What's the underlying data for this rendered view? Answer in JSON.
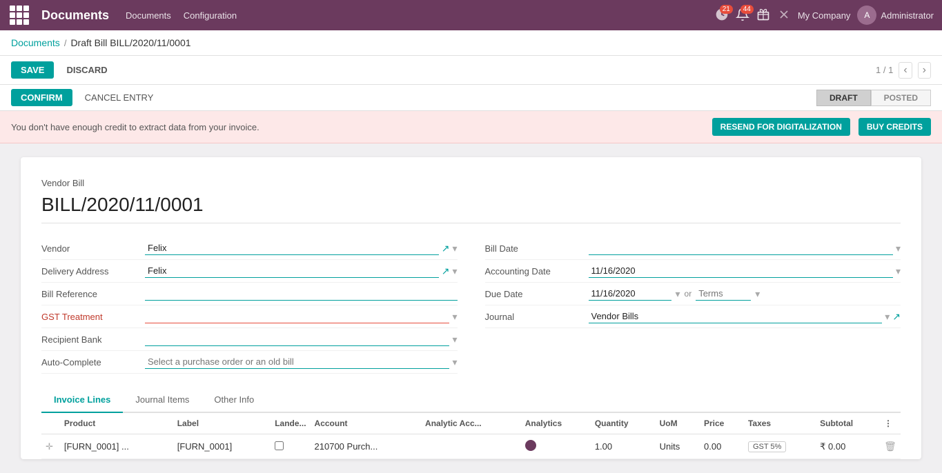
{
  "topnav": {
    "title": "Documents",
    "menu": [
      "Documents",
      "Configuration"
    ],
    "notifications1_count": "21",
    "notifications2_count": "44",
    "company": "My Company",
    "user": "Administrator"
  },
  "breadcrumb": {
    "parent": "Documents",
    "separator": "/",
    "current": "Draft Bill BILL/2020/11/0001"
  },
  "toolbar": {
    "save_label": "SAVE",
    "discard_label": "DISCARD",
    "pagination": "1 / 1"
  },
  "status_bar": {
    "confirm_label": "CONFIRM",
    "cancel_entry_label": "CANCEL ENTRY",
    "tabs": [
      "DRAFT",
      "POSTED"
    ]
  },
  "alert": {
    "message": "You don't have enough credit to extract data from your invoice.",
    "resend_label": "RESEND FOR DIGITALIZATION",
    "buy_label": "BUY CREDITS"
  },
  "form": {
    "vendor_bill_label": "Vendor Bill",
    "bill_number": "BILL/2020/11/0001",
    "vendor_label": "Vendor",
    "vendor_value": "Felix",
    "delivery_address_label": "Delivery Address",
    "delivery_address_value": "Felix",
    "bill_reference_label": "Bill Reference",
    "bill_reference_value": "",
    "gst_treatment_label": "GST Treatment",
    "gst_treatment_value": "",
    "recipient_bank_label": "Recipient Bank",
    "recipient_bank_value": "",
    "auto_complete_label": "Auto-Complete",
    "auto_complete_placeholder": "Select a purchase order or an old bill",
    "bill_date_label": "Bill Date",
    "bill_date_value": "",
    "accounting_date_label": "Accounting Date",
    "accounting_date_value": "11/16/2020",
    "due_date_label": "Due Date",
    "due_date_value": "11/16/2020",
    "terms_label": "Terms",
    "journal_label": "Journal",
    "journal_value": "Vendor Bills"
  },
  "tabs": {
    "invoice_lines": "Invoice Lines",
    "journal_items": "Journal Items",
    "other_info": "Other Info"
  },
  "table": {
    "columns": [
      "Product",
      "Label",
      "Lande...",
      "Account",
      "Analytic Acc...",
      "Analytics",
      "Quantity",
      "UoM",
      "Price",
      "Taxes",
      "Subtotal"
    ],
    "rows": [
      {
        "product": "[FURN_0001] ...",
        "label": "[FURN_0001]",
        "lande": "",
        "account": "210700 Purch...",
        "analytic_acc": "",
        "analytics": "",
        "quantity": "1.00",
        "uom": "Units",
        "price": "0.00",
        "taxes": "GST 5%",
        "subtotal": "₹ 0.00"
      }
    ]
  }
}
